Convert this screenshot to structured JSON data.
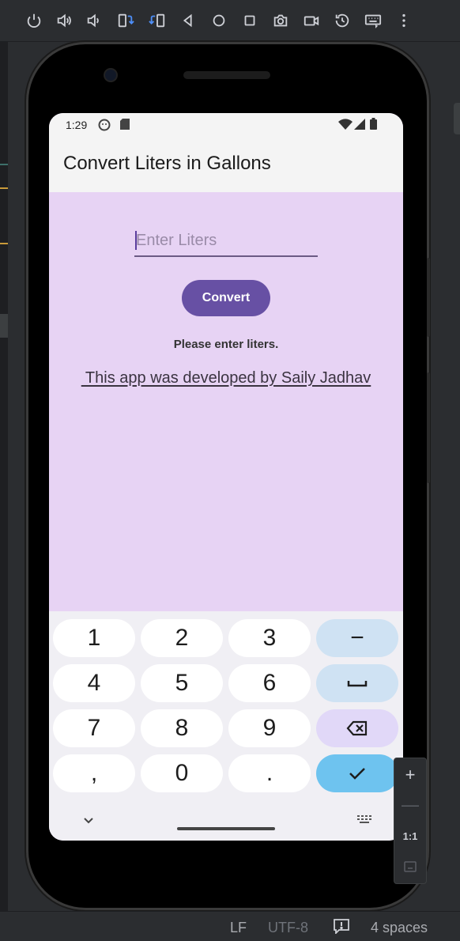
{
  "ide": {
    "toolbar_icons": [
      "power-icon",
      "volume-up-icon",
      "volume-down-icon",
      "rotate-left-icon",
      "rotate-right-icon",
      "back-icon",
      "home-icon",
      "overview-icon",
      "camera-icon",
      "screen-record-icon",
      "snapshot-icon",
      "keyboard-icon",
      "more-icon"
    ],
    "status": {
      "line_separator": "LF",
      "encoding": "UTF-8",
      "indent": "4 spaces"
    },
    "zoom": {
      "zoom_in": "+",
      "zoom_out": "—",
      "ratio": "1:1"
    }
  },
  "device": {
    "status_bar": {
      "time": "1:29"
    },
    "app": {
      "title": "Convert Liters in Gallons",
      "input": {
        "placeholder": "Enter Liters",
        "value": ""
      },
      "convert_label": "Convert",
      "result_text": "Please enter liters.",
      "developer_text": " This app was developed by Saily Jadhav"
    },
    "keyboard": {
      "rows": [
        [
          "1",
          "2",
          "3",
          "−"
        ],
        [
          "4",
          "5",
          "6",
          "space"
        ],
        [
          "7",
          "8",
          "9",
          "backspace"
        ],
        [
          ",",
          "0",
          ".",
          "done"
        ]
      ]
    }
  },
  "colors": {
    "app_background": "#e7d3f4",
    "button": "#6750a4",
    "confirm_key": "#6ec3ef"
  }
}
